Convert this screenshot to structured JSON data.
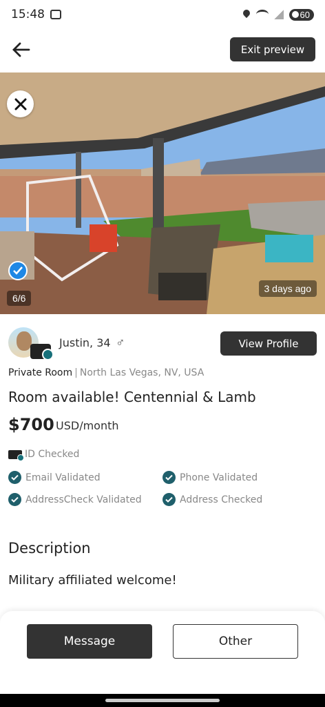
{
  "status": {
    "time": "15:48",
    "battery": "60"
  },
  "topbar": {
    "exit_label": "Exit preview"
  },
  "photo": {
    "counter": "6/6",
    "posted_ago": "3 days ago"
  },
  "profile": {
    "name_age": "Justin, 34",
    "gender_symbol": "♂",
    "view_label": "View Profile"
  },
  "listing": {
    "room_type": "Private Room",
    "separator": "|",
    "location": "North Las Vegas, NV, USA",
    "title": "Room available! Centennial & Lamb",
    "price": "$700",
    "price_unit": "USD/month"
  },
  "verification": {
    "id": "ID Checked",
    "items": [
      "Email Validated",
      "Phone Validated",
      "AddressCheck Validated",
      "Address Checked"
    ]
  },
  "description": {
    "heading": "Description",
    "text": "Military affiliated welcome!"
  },
  "actions": {
    "message_label": "Message",
    "other_label": "Other"
  },
  "colors": {
    "dark_button": "#333333",
    "check_teal": "#1f5f6b",
    "verified_blue": "#1e88e5"
  },
  "icons": [
    "back-arrow-icon",
    "close-icon",
    "verified-check-icon",
    "male-icon",
    "id-card-icon",
    "check-circle-icon"
  ]
}
